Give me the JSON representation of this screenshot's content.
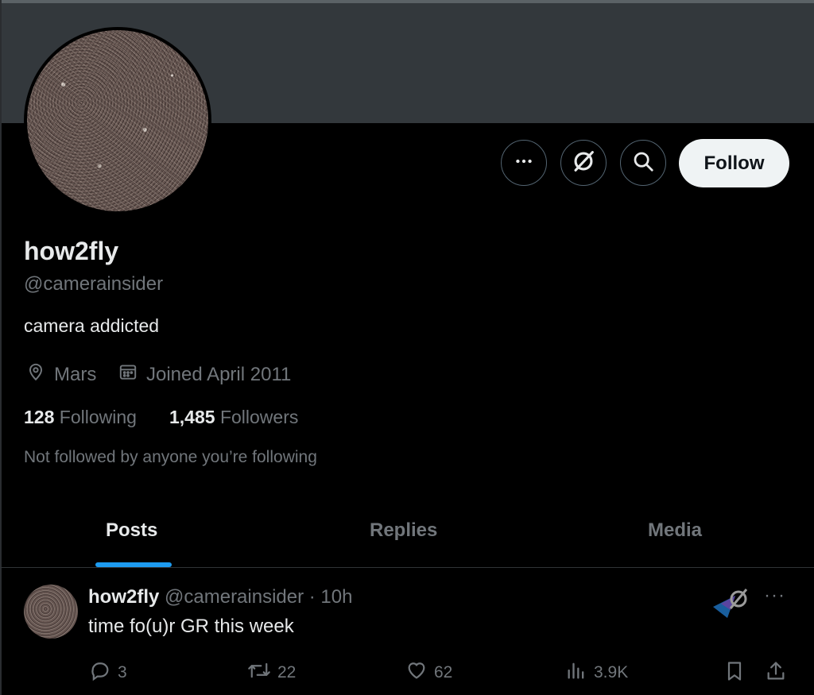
{
  "profile": {
    "display_name": "how2fly",
    "handle": "@camerainsider",
    "bio": "camera addicted",
    "location": "Mars",
    "joined": "Joined April 2011",
    "following_count": "128",
    "following_label": "Following",
    "followers_count": "1,485",
    "followers_label": "Followers",
    "not_followed_text": "Not followed by anyone you’re following"
  },
  "actions": {
    "more_icon": "more-horizontal-icon",
    "grok_icon": "grok-icon",
    "search_icon": "search-icon",
    "follow_label": "Follow"
  },
  "tabs": [
    {
      "label": "Posts",
      "active": true
    },
    {
      "label": "Replies",
      "active": false
    },
    {
      "label": "Media",
      "active": false
    }
  ],
  "post": {
    "author": "how2fly",
    "meta": "@camerainsider · 10h",
    "text": "time fo(u)r GR this week",
    "more": "···",
    "replies": "3",
    "reposts": "22",
    "likes": "62",
    "views": "3.9K"
  },
  "colors": {
    "background": "#000000",
    "banner": "#33383c",
    "accent": "#1d9bf0",
    "muted_text": "#71767b",
    "follow_button": "#eff3f4"
  }
}
